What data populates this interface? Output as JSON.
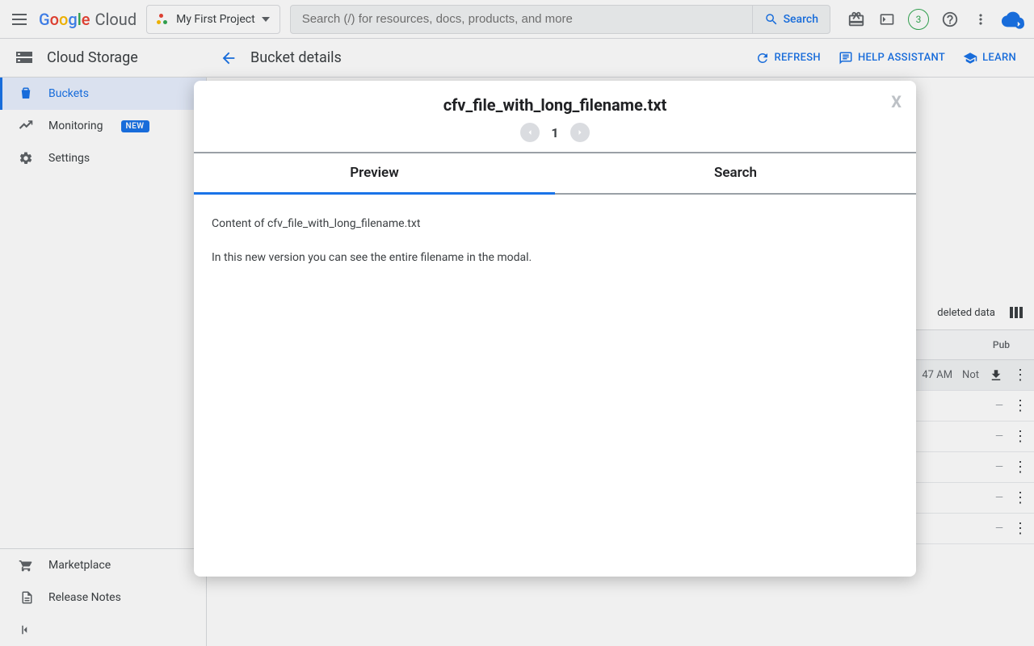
{
  "topbar": {
    "project_label": "My First Project",
    "search_placeholder": "Search (/) for resources, docs, products, and more",
    "search_button": "Search",
    "notif_count": "3"
  },
  "subheader": {
    "product_title": "Cloud Storage",
    "page_title": "Bucket details",
    "refresh": "REFRESH",
    "help_assistant": "HELP ASSISTANT",
    "learn": "LEARN"
  },
  "sidebar": {
    "buckets": "Buckets",
    "monitoring": "Monitoring",
    "monitoring_badge": "NEW",
    "settings": "Settings",
    "marketplace": "Marketplace",
    "release_notes": "Release Notes"
  },
  "peek": {
    "deleted_data": "deleted data",
    "col_pub": "Pub",
    "row0_time": "47 AM",
    "row0_pub": "Not"
  },
  "modal": {
    "title": "cfv_file_with_long_filename.txt",
    "close": "X",
    "page": "1",
    "tab_preview": "Preview",
    "tab_search": "Search",
    "content": "Content of cfv_file_with_long_filename.txt\n\nIn this new version you can see the entire filename in the modal."
  }
}
